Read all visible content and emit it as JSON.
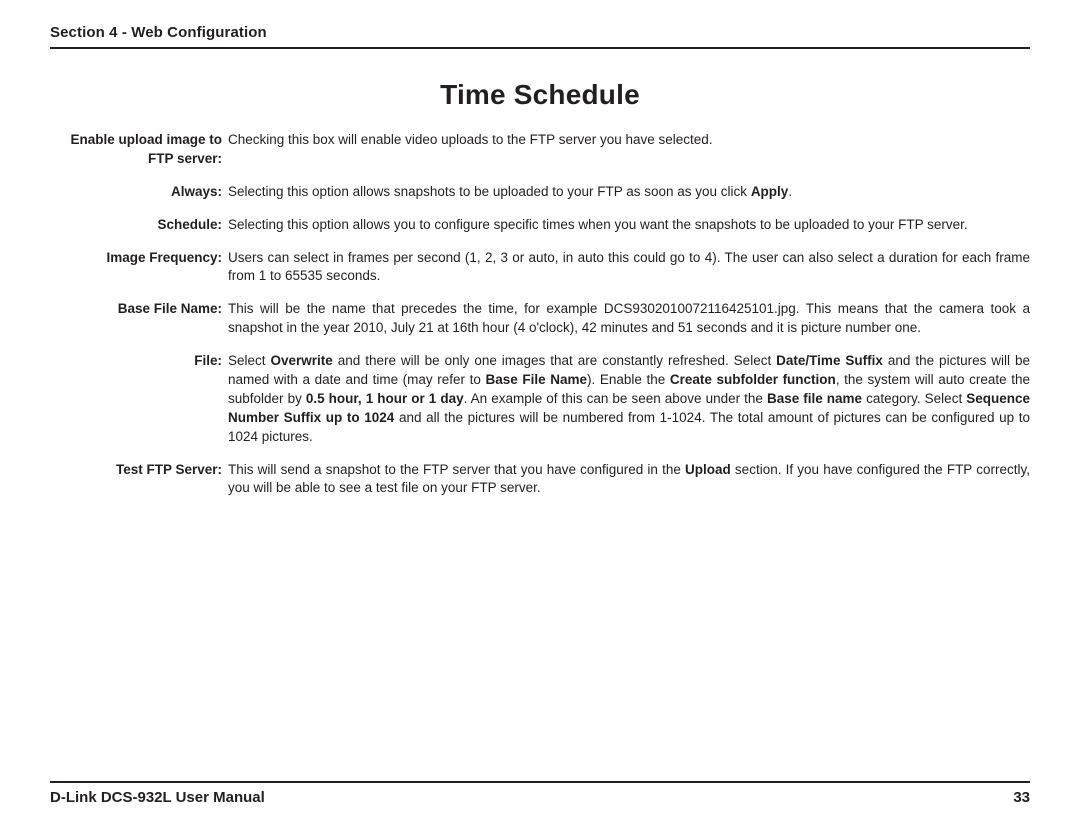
{
  "section_header": "Section 4 - Web Configuration",
  "page_title": "Time Schedule",
  "rows": {
    "r0": {
      "term_l1": "Enable upload image to",
      "term_l2": "FTP server:",
      "desc": "Checking this box will enable video uploads to the FTP server you have selected."
    },
    "r1": {
      "term": "Always:",
      "a": "Selecting this option allows snapshots to be uploaded to your FTP as soon as you click ",
      "b": "Apply",
      "c": "."
    },
    "r2": {
      "term": "Schedule:",
      "desc": "Selecting this option allows you to configure specific times when you want the snapshots to be uploaded to your FTP server."
    },
    "r3": {
      "term": "Image Frequency:",
      "desc": "Users can select in frames per second (1, 2, 3 or auto, in auto this could go to 4). The user can also select a duration for each frame from 1 to 65535 seconds."
    },
    "r4": {
      "term": "Base File Name:",
      "desc": "This will be the name that precedes the time, for example DCS9302010072116425101.jpg. This means that the camera took a snapshot in the year 2010, July 21 at 16th hour (4 o'clock), 42 minutes and 51 seconds and it is picture number one."
    },
    "r5": {
      "term": "File:",
      "p1": "Select ",
      "b1": "Overwrite",
      "p2": " and there will be only one images that are constantly refreshed. Select ",
      "b2": "Date/Time Suffix",
      "p3": " and the pictures will be named with a date and time (may refer to ",
      "b3": "Base File Name",
      "p4": "). Enable the ",
      "b4": "Create subfolder function",
      "p5": ", the system will auto create the subfolder by ",
      "b5": "0.5 hour, 1 hour or 1 day",
      "p6": ". An example of this can be seen above under the ",
      "b6": "Base file name",
      "p7": " category. Select ",
      "b7": "Sequence Number Suffix up to 1024",
      "p8": " and all the pictures will be numbered from 1-1024. The total amount of pictures can be configured up to 1024 pictures."
    },
    "r6": {
      "term": "Test FTP Server:",
      "p1": "This will send a snapshot to the FTP server that you have configured in the ",
      "b1": "Upload",
      "p2": " section. If you have configured the FTP correctly, you will be able to see a test file on your FTP server."
    }
  },
  "footer_left": "D-Link DCS-932L User Manual",
  "footer_right": "33"
}
